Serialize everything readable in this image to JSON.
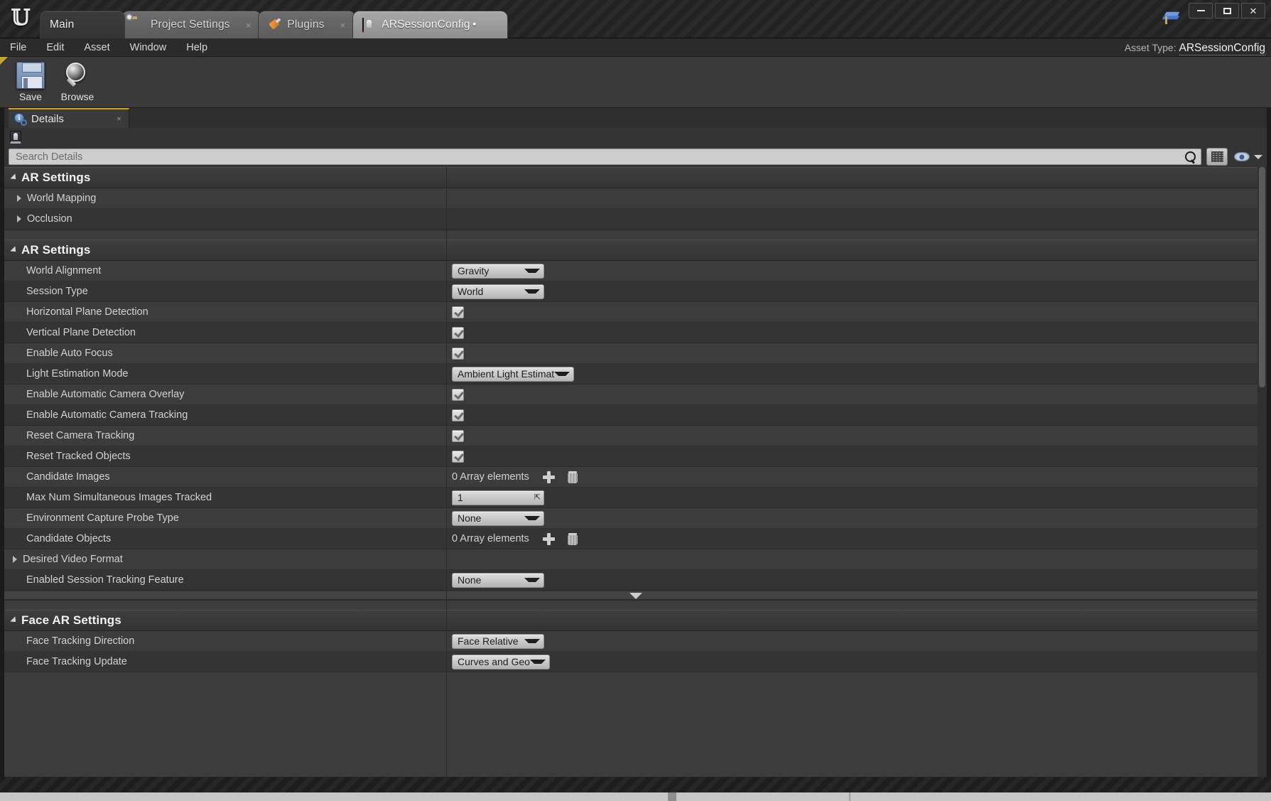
{
  "window": {
    "logo": "unreal-logo",
    "tabs": [
      {
        "label": "Main",
        "icon": "none",
        "state": "active",
        "closable": false
      },
      {
        "label": "Project Settings",
        "icon": "folder-gear-icon",
        "state": "normal",
        "closable": true,
        "close": "×"
      },
      {
        "label": "Plugins",
        "icon": "plug-icon",
        "state": "normal",
        "closable": true,
        "close": "×"
      },
      {
        "label": "ARSessionConfig •",
        "icon": "arsessionconfig-icon",
        "state": "selected",
        "closable": true,
        "close": "×"
      }
    ],
    "controls": {
      "minimize": "minimize",
      "maximize": "maximize",
      "close": "✕"
    }
  },
  "menubar": {
    "items": [
      "File",
      "Edit",
      "Asset",
      "Window",
      "Help"
    ],
    "asset_type_label": "Asset Type:",
    "asset_type_value": "ARSessionConfig"
  },
  "toolbar": {
    "buttons": [
      {
        "label": "Save",
        "icon": "save-icon"
      },
      {
        "label": "Browse",
        "icon": "browse-icon"
      }
    ]
  },
  "details_panel": {
    "tab_label": "Details",
    "tab_icon": "details-info-icon",
    "tab_close": "×",
    "object_icon": "arsessionconfig-asset-icon"
  },
  "search": {
    "placeholder": "Search Details",
    "value": "",
    "icon": "search-icon",
    "grid_view_icon": "grid-view-icon",
    "visibility_icon": "eye-icon",
    "visibility_caret": "chevron-down-icon"
  },
  "sections": [
    {
      "title": "AR Settings",
      "rows": [
        {
          "name": "World Mapping",
          "type": "group",
          "expanded": false
        },
        {
          "name": "Occlusion",
          "type": "group",
          "expanded": false
        }
      ]
    },
    {
      "title": "AR Settings",
      "rows": [
        {
          "name": "World Alignment",
          "type": "combo",
          "value": "Gravity"
        },
        {
          "name": "Session Type",
          "type": "combo",
          "value": "World"
        },
        {
          "name": "Horizontal Plane Detection",
          "type": "checkbox",
          "value": true
        },
        {
          "name": "Vertical Plane Detection",
          "type": "checkbox",
          "value": true
        },
        {
          "name": "Enable Auto Focus",
          "type": "checkbox",
          "value": true
        },
        {
          "name": "Light Estimation Mode",
          "type": "combo-wide",
          "value": "Ambient Light Estimate"
        },
        {
          "name": "Enable Automatic Camera Overlay",
          "type": "checkbox",
          "value": true
        },
        {
          "name": "Enable Automatic Camera Tracking",
          "type": "checkbox",
          "value": true
        },
        {
          "name": "Reset Camera Tracking",
          "type": "checkbox",
          "value": true
        },
        {
          "name": "Reset Tracked Objects",
          "type": "checkbox",
          "value": true
        },
        {
          "name": "Candidate Images",
          "type": "array",
          "value": "0 Array elements"
        },
        {
          "name": "Max Num Simultaneous Images Tracked",
          "type": "number",
          "value": "1"
        },
        {
          "name": "Environment Capture Probe Type",
          "type": "combo",
          "value": "None"
        },
        {
          "name": "Candidate Objects",
          "type": "array",
          "value": "0 Array elements"
        },
        {
          "name": "Desired Video Format",
          "type": "group",
          "expanded": false
        },
        {
          "name": "Enabled Session Tracking Feature",
          "type": "combo",
          "value": "None"
        }
      ],
      "expander": "show-more-arrow"
    },
    {
      "title": "Face AR Settings",
      "rows": [
        {
          "name": "Face Tracking Direction",
          "type": "combo",
          "value": "Face Relative"
        },
        {
          "name": "Face Tracking Update",
          "type": "combo",
          "value": "Curves and Geo"
        }
      ]
    }
  ],
  "colors": {
    "accent_tab": "#c8a62c",
    "panel_bg": "#3c3c3c",
    "row_dark": "#343434",
    "row_light": "#3c3c3c",
    "asset_accent": "#d41a66"
  }
}
